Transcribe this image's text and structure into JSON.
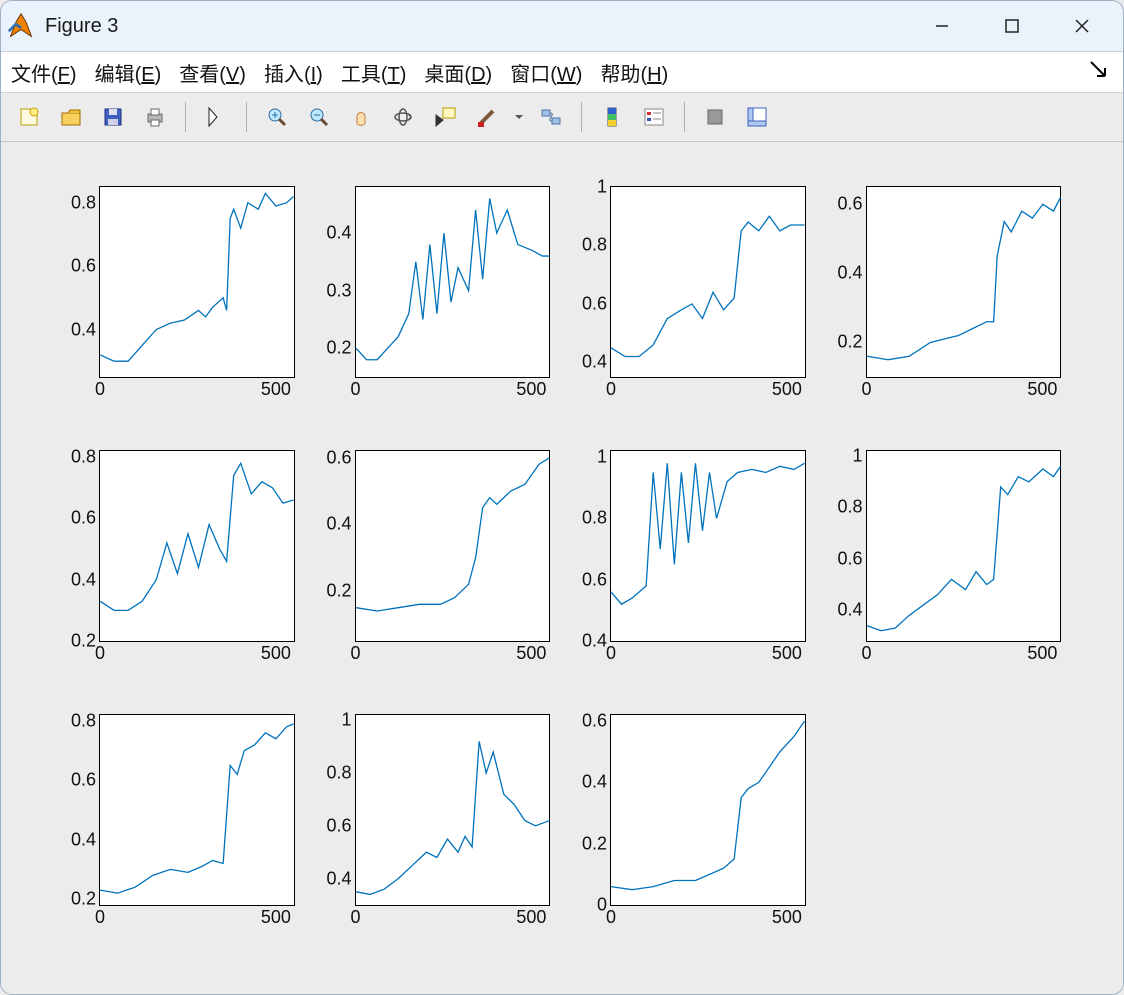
{
  "window": {
    "title": "Figure 3"
  },
  "menu": {
    "file": {
      "label": "文件",
      "accel": "F"
    },
    "edit": {
      "label": "编辑",
      "accel": "E"
    },
    "view": {
      "label": "查看",
      "accel": "V"
    },
    "insert": {
      "label": "插入",
      "accel": "I"
    },
    "tools": {
      "label": "工具",
      "accel": "T"
    },
    "desktop": {
      "label": "桌面",
      "accel": "D"
    },
    "window": {
      "label": "窗口",
      "accel": "W"
    },
    "help": {
      "label": "帮助",
      "accel": "H"
    }
  },
  "toolbar_icons": [
    "new-figure",
    "open",
    "save",
    "print",
    "edit-plot",
    "zoom-in",
    "zoom-out",
    "pan",
    "rotate-3d",
    "data-cursor",
    "brush",
    "link",
    "insert-colorbar",
    "insert-legend",
    "hide-plot-tools",
    "show-plot-tools"
  ],
  "chart_data": [
    {
      "type": "line",
      "x_range": [
        0,
        550
      ],
      "y_range": [
        0.25,
        0.85
      ],
      "xticks": [
        0,
        500
      ],
      "yticks": [
        0.4,
        0.6,
        0.8
      ],
      "series": [
        {
          "x": [
            0,
            40,
            80,
            120,
            160,
            200,
            240,
            280,
            300,
            320,
            350,
            360,
            370,
            380,
            400,
            420,
            450,
            470,
            500,
            530,
            550
          ],
          "y": [
            0.32,
            0.3,
            0.3,
            0.35,
            0.4,
            0.42,
            0.43,
            0.46,
            0.44,
            0.47,
            0.5,
            0.46,
            0.75,
            0.78,
            0.72,
            0.8,
            0.78,
            0.83,
            0.79,
            0.8,
            0.82
          ]
        }
      ]
    },
    {
      "type": "line",
      "x_range": [
        0,
        550
      ],
      "y_range": [
        0.15,
        0.48
      ],
      "xticks": [
        0,
        500
      ],
      "yticks": [
        0.2,
        0.3,
        0.4
      ],
      "series": [
        {
          "x": [
            0,
            30,
            60,
            90,
            120,
            150,
            170,
            190,
            210,
            230,
            250,
            270,
            290,
            320,
            340,
            360,
            380,
            400,
            430,
            460,
            500,
            530,
            550
          ],
          "y": [
            0.2,
            0.18,
            0.18,
            0.2,
            0.22,
            0.26,
            0.35,
            0.25,
            0.38,
            0.26,
            0.4,
            0.28,
            0.34,
            0.3,
            0.44,
            0.32,
            0.46,
            0.4,
            0.44,
            0.38,
            0.37,
            0.36,
            0.36
          ]
        }
      ]
    },
    {
      "type": "line",
      "x_range": [
        0,
        550
      ],
      "y_range": [
        0.35,
        1.0
      ],
      "xticks": [
        0,
        500
      ],
      "yticks": [
        0.4,
        0.6,
        0.8,
        1
      ],
      "series": [
        {
          "x": [
            0,
            40,
            80,
            120,
            160,
            200,
            230,
            260,
            290,
            320,
            350,
            370,
            390,
            420,
            450,
            480,
            510,
            550
          ],
          "y": [
            0.45,
            0.42,
            0.42,
            0.46,
            0.55,
            0.58,
            0.6,
            0.55,
            0.64,
            0.58,
            0.62,
            0.85,
            0.88,
            0.85,
            0.9,
            0.85,
            0.87,
            0.87
          ]
        }
      ]
    },
    {
      "type": "line",
      "x_range": [
        0,
        550
      ],
      "y_range": [
        0.1,
        0.65
      ],
      "xticks": [
        0,
        500
      ],
      "yticks": [
        0.2,
        0.4,
        0.6
      ],
      "series": [
        {
          "x": [
            0,
            60,
            120,
            180,
            220,
            260,
            300,
            340,
            360,
            370,
            390,
            410,
            440,
            470,
            500,
            530,
            550
          ],
          "y": [
            0.16,
            0.15,
            0.16,
            0.2,
            0.21,
            0.22,
            0.24,
            0.26,
            0.26,
            0.45,
            0.55,
            0.52,
            0.58,
            0.56,
            0.6,
            0.58,
            0.62
          ]
        }
      ]
    },
    {
      "type": "line",
      "x_range": [
        0,
        550
      ],
      "y_range": [
        0.2,
        0.82
      ],
      "xticks": [
        0,
        500
      ],
      "yticks": [
        0.2,
        0.4,
        0.6,
        0.8
      ],
      "series": [
        {
          "x": [
            0,
            40,
            80,
            120,
            160,
            190,
            220,
            250,
            280,
            310,
            340,
            360,
            380,
            400,
            430,
            460,
            490,
            520,
            550
          ],
          "y": [
            0.33,
            0.3,
            0.3,
            0.33,
            0.4,
            0.52,
            0.42,
            0.55,
            0.44,
            0.58,
            0.5,
            0.46,
            0.74,
            0.78,
            0.68,
            0.72,
            0.7,
            0.65,
            0.66
          ]
        }
      ]
    },
    {
      "type": "line",
      "x_range": [
        0,
        550
      ],
      "y_range": [
        0.05,
        0.62
      ],
      "xticks": [
        0,
        500
      ],
      "yticks": [
        0.2,
        0.4,
        0.6
      ],
      "series": [
        {
          "x": [
            0,
            60,
            120,
            180,
            240,
            280,
            320,
            340,
            360,
            380,
            400,
            440,
            480,
            520,
            550
          ],
          "y": [
            0.15,
            0.14,
            0.15,
            0.16,
            0.16,
            0.18,
            0.22,
            0.3,
            0.45,
            0.48,
            0.46,
            0.5,
            0.52,
            0.58,
            0.6
          ]
        }
      ]
    },
    {
      "type": "line",
      "x_range": [
        0,
        550
      ],
      "y_range": [
        0.4,
        1.02
      ],
      "xticks": [
        0,
        500
      ],
      "yticks": [
        0.4,
        0.6,
        0.8,
        1
      ],
      "series": [
        {
          "x": [
            0,
            30,
            60,
            80,
            100,
            120,
            140,
            160,
            180,
            200,
            220,
            240,
            260,
            280,
            300,
            330,
            360,
            400,
            440,
            480,
            520,
            550
          ],
          "y": [
            0.56,
            0.52,
            0.54,
            0.56,
            0.58,
            0.95,
            0.7,
            0.98,
            0.65,
            0.95,
            0.72,
            0.98,
            0.76,
            0.95,
            0.8,
            0.92,
            0.95,
            0.96,
            0.95,
            0.97,
            0.96,
            0.98
          ]
        }
      ]
    },
    {
      "type": "line",
      "x_range": [
        0,
        550
      ],
      "y_range": [
        0.28,
        1.02
      ],
      "xticks": [
        0,
        500
      ],
      "yticks": [
        0.4,
        0.6,
        0.8,
        1
      ],
      "series": [
        {
          "x": [
            0,
            40,
            80,
            120,
            160,
            200,
            240,
            280,
            310,
            340,
            360,
            380,
            400,
            430,
            460,
            500,
            530,
            550
          ],
          "y": [
            0.34,
            0.32,
            0.33,
            0.38,
            0.42,
            0.46,
            0.52,
            0.48,
            0.55,
            0.5,
            0.52,
            0.88,
            0.85,
            0.92,
            0.9,
            0.95,
            0.92,
            0.96
          ]
        }
      ]
    },
    {
      "type": "line",
      "x_range": [
        0,
        550
      ],
      "y_range": [
        0.18,
        0.82
      ],
      "xticks": [
        0,
        500
      ],
      "yticks": [
        0.2,
        0.4,
        0.6,
        0.8
      ],
      "series": [
        {
          "x": [
            0,
            50,
            100,
            150,
            200,
            250,
            290,
            320,
            350,
            370,
            390,
            410,
            440,
            470,
            500,
            530,
            550
          ],
          "y": [
            0.23,
            0.22,
            0.24,
            0.28,
            0.3,
            0.29,
            0.31,
            0.33,
            0.32,
            0.65,
            0.62,
            0.7,
            0.72,
            0.76,
            0.74,
            0.78,
            0.79
          ]
        }
      ]
    },
    {
      "type": "line",
      "x_range": [
        0,
        550
      ],
      "y_range": [
        0.3,
        1.02
      ],
      "xticks": [
        0,
        500
      ],
      "yticks": [
        0.4,
        0.6,
        0.8,
        1
      ],
      "series": [
        {
          "x": [
            0,
            40,
            80,
            120,
            160,
            200,
            230,
            260,
            290,
            310,
            330,
            350,
            370,
            390,
            420,
            450,
            480,
            510,
            550
          ],
          "y": [
            0.35,
            0.34,
            0.36,
            0.4,
            0.45,
            0.5,
            0.48,
            0.55,
            0.5,
            0.56,
            0.52,
            0.92,
            0.8,
            0.88,
            0.72,
            0.68,
            0.62,
            0.6,
            0.62
          ]
        }
      ]
    },
    {
      "type": "line",
      "x_range": [
        0,
        550
      ],
      "y_range": [
        0.0,
        0.62
      ],
      "xticks": [
        0,
        500
      ],
      "yticks": [
        0,
        0.2,
        0.4,
        0.6
      ],
      "series": [
        {
          "x": [
            0,
            60,
            120,
            180,
            240,
            280,
            320,
            350,
            370,
            390,
            420,
            450,
            480,
            520,
            550
          ],
          "y": [
            0.06,
            0.05,
            0.06,
            0.08,
            0.08,
            0.1,
            0.12,
            0.15,
            0.35,
            0.38,
            0.4,
            0.45,
            0.5,
            0.55,
            0.6
          ]
        }
      ]
    }
  ]
}
